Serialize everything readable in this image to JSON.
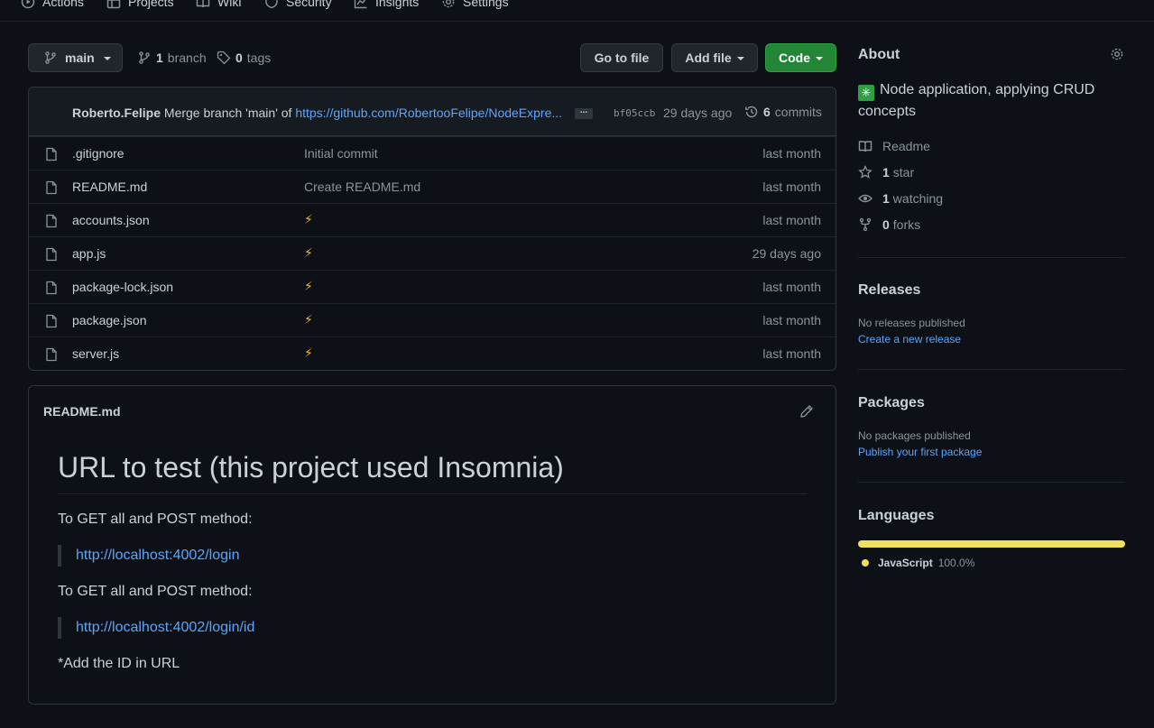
{
  "nav": {
    "items": [
      {
        "label": "Actions",
        "icon": "play-icon"
      },
      {
        "label": "Projects",
        "icon": "table-icon"
      },
      {
        "label": "Wiki",
        "icon": "book-icon"
      },
      {
        "label": "Security",
        "icon": "shield-icon"
      },
      {
        "label": "Insights",
        "icon": "graph-icon"
      },
      {
        "label": "Settings",
        "icon": "gear-icon"
      }
    ]
  },
  "toolbar": {
    "branch": "main",
    "branches_count": "1",
    "branches_label": "branch",
    "tags_count": "0",
    "tags_label": "tags",
    "go_to_file": "Go to file",
    "add_file": "Add file",
    "code": "Code"
  },
  "commit": {
    "author": "Roberto.Felipe",
    "message": "Merge branch 'main' of",
    "link": "https://github.com/RobertooFelipe/NodeExpre...",
    "ellipsis": "...",
    "sha": "bf05ccb",
    "time": "29 days ago",
    "count": "6",
    "count_label": "commits"
  },
  "files": [
    {
      "name": ".gitignore",
      "message": "Initial commit",
      "time": "last month"
    },
    {
      "name": "README.md",
      "message": "Create README.md",
      "time": "last month"
    },
    {
      "name": "accounts.json",
      "message": "⚡",
      "time": "last month"
    },
    {
      "name": "app.js",
      "message": "⚡",
      "time": "29 days ago"
    },
    {
      "name": "package-lock.json",
      "message": "⚡",
      "time": "last month"
    },
    {
      "name": "package.json",
      "message": "⚡",
      "time": "last month"
    },
    {
      "name": "server.js",
      "message": "⚡",
      "time": "last month"
    }
  ],
  "readme": {
    "filename": "README.md",
    "heading": "URL to test (this project used Insomnia)",
    "p1": "To GET all and POST method:",
    "link1": "http://localhost:4002/login",
    "p2": "To GET all and POST method:",
    "link2": "http://localhost:4002/login/id",
    "p3": "*Add the ID in URL"
  },
  "about": {
    "title": "About",
    "description": "Node application, applying CRUD concepts",
    "readme": "Readme",
    "stars_count": "1",
    "stars_label": "star",
    "watching_count": "1",
    "watching_label": "watching",
    "forks_count": "0",
    "forks_label": "forks"
  },
  "releases": {
    "title": "Releases",
    "empty": "No releases published",
    "link": "Create a new release"
  },
  "packages": {
    "title": "Packages",
    "empty": "No packages published",
    "link": "Publish your first package"
  },
  "languages": {
    "title": "Languages",
    "items": [
      {
        "name": "JavaScript",
        "percent": "100.0%",
        "color": "#f1e05a"
      }
    ]
  }
}
